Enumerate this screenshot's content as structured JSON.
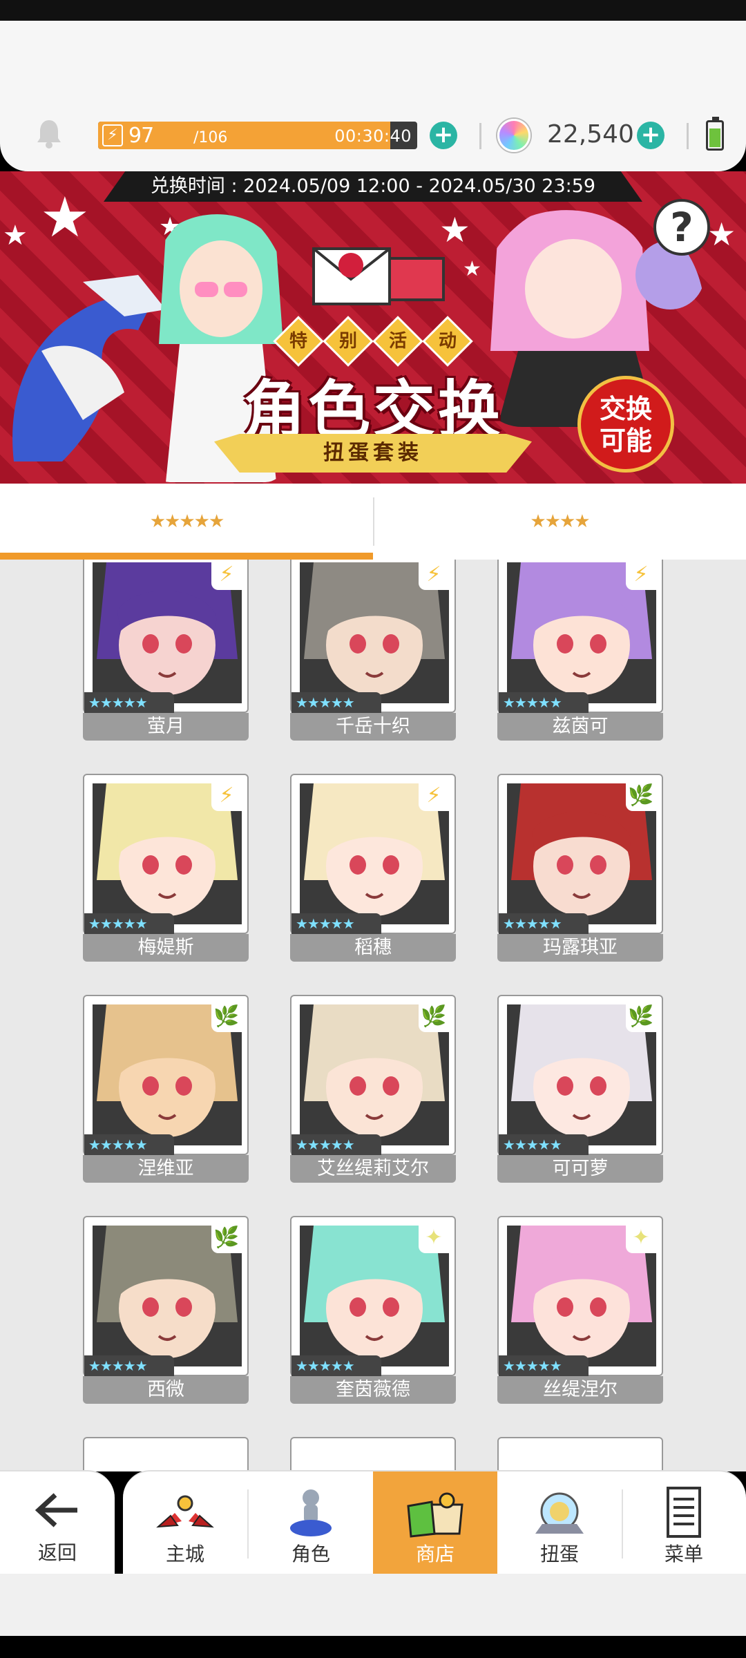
{
  "topbar": {
    "stamina_current": "97",
    "stamina_max": "/106",
    "stamina_fraction": 0.915,
    "stamina_timer": "00:30:40",
    "gems": "22,540",
    "accent": "#f4a236",
    "plus_color": "#2bb5a4"
  },
  "banner": {
    "exchange_time": "兑换时间 : 2024.05/09 12:00 - 2024.05/30 23:59",
    "event_chars": [
      "特",
      "别",
      "活",
      "动"
    ],
    "title": "角色交换",
    "ribbon": "扭蛋套装",
    "badge_line1": "交换",
    "badge_line2": "可能",
    "help_icon": "?"
  },
  "tabs": [
    {
      "label": "★★★★★",
      "active": true
    },
    {
      "label": "★★★★",
      "active": false
    }
  ],
  "cards": [
    {
      "name": "萤月",
      "stars": "★★★★★",
      "element": "lightning"
    },
    {
      "name": "千岳十织",
      "stars": "★★★★★",
      "element": "lightning"
    },
    {
      "name": "兹茵可",
      "stars": "★★★★★",
      "element": "lightning"
    },
    {
      "name": "梅媞斯",
      "stars": "★★★★★",
      "element": "lightning"
    },
    {
      "name": "稻穗",
      "stars": "★★★★★",
      "element": "lightning"
    },
    {
      "name": "玛露琪亚",
      "stars": "★★★★★",
      "element": "leaf"
    },
    {
      "name": "涅维亚",
      "stars": "★★★★★",
      "element": "leaf"
    },
    {
      "name": "艾丝缇莉艾尔",
      "stars": "★★★★★",
      "element": "leaf"
    },
    {
      "name": "可可萝",
      "stars": "★★★★★",
      "element": "leaf"
    },
    {
      "name": "西微",
      "stars": "★★★★★",
      "element": "leaf"
    },
    {
      "name": "奎茵薇德",
      "stars": "★★★★★",
      "element": "sparkle"
    },
    {
      "name": "丝缇涅尔",
      "stars": "★★★★★",
      "element": "sparkle"
    }
  ],
  "nav": {
    "back": "返回",
    "items": [
      "主城",
      "角色",
      "商店",
      "扭蛋",
      "菜单"
    ],
    "active": "商店"
  }
}
